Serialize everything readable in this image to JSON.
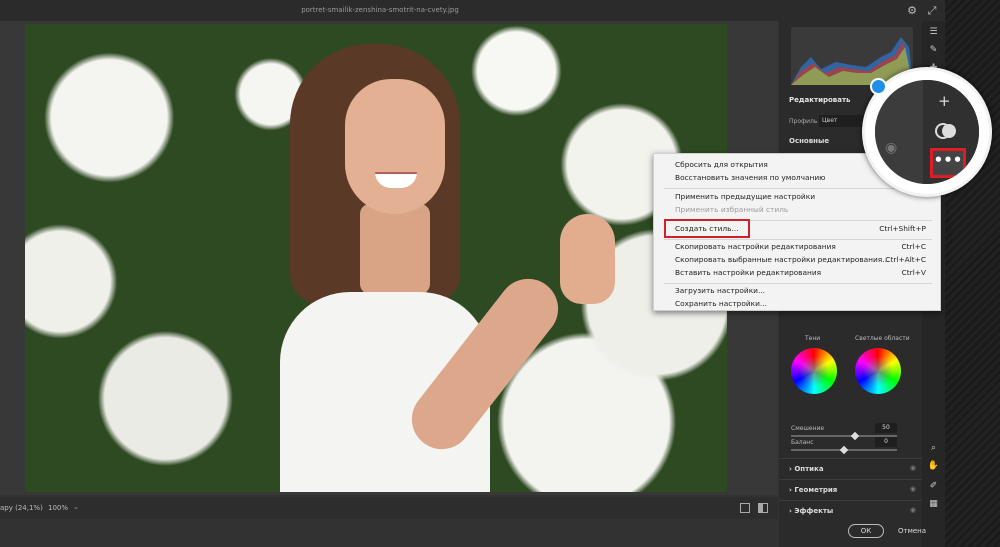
{
  "titlebar": {
    "filename": "portret-smailik-zenshina-smotrit-na-cvety.jpg"
  },
  "statusbar": {
    "fit_label": "ару (24,1%)",
    "zoom_label": "100%",
    "caret": "⌄"
  },
  "panel": {
    "edit_title": "Редактировать",
    "profile_label": "Профиль",
    "profile_value": "Цвет",
    "basic_label": "Основные",
    "shadows_label": "Тени",
    "highlights_label": "Светлые области",
    "blending_label": "Смешение",
    "blending_value": "50",
    "balance_label": "Баланс",
    "balance_value": "0",
    "optics_label": "Оптика",
    "geometry_label": "Геометрия",
    "effects_label": "Эффекты",
    "blending_fraction": 0.6,
    "balance_fraction": 0.5
  },
  "buttons": {
    "ok": "ОК",
    "cancel": "Отмена"
  },
  "menu": {
    "items": [
      {
        "label": "Сбросить для открытия",
        "shortcut": "",
        "disabled": false
      },
      {
        "label": "Восстановить значения по умолчанию",
        "shortcut": "",
        "disabled": false
      },
      {
        "label": "Применить предыдущие настройки",
        "shortcut": "",
        "disabled": false
      },
      {
        "label": "Применить избранный стиль",
        "shortcut": "",
        "disabled": true
      },
      {
        "label": "Создать стиль...",
        "shortcut": "Ctrl+Shift+P",
        "disabled": false
      },
      {
        "label": "Скопировать настройки редактирования",
        "shortcut": "Ctrl+C",
        "disabled": false
      },
      {
        "label": "Скопировать выбранные настройки редактирования...",
        "shortcut": "Ctrl+Alt+C",
        "disabled": false
      },
      {
        "label": "Вставить настройки редактирования",
        "shortcut": "Ctrl+V",
        "disabled": false
      },
      {
        "label": "Загрузить настройки...",
        "shortcut": "",
        "disabled": false
      },
      {
        "label": "Сохранить настройки...",
        "shortcut": "",
        "disabled": false
      }
    ]
  },
  "icons": {
    "settings": "gear-icon",
    "expand": "expand-icon",
    "more": "more-icon"
  },
  "colors": {
    "highlight_red": "#d0202a",
    "accent_blue": "#1e8ee8"
  }
}
